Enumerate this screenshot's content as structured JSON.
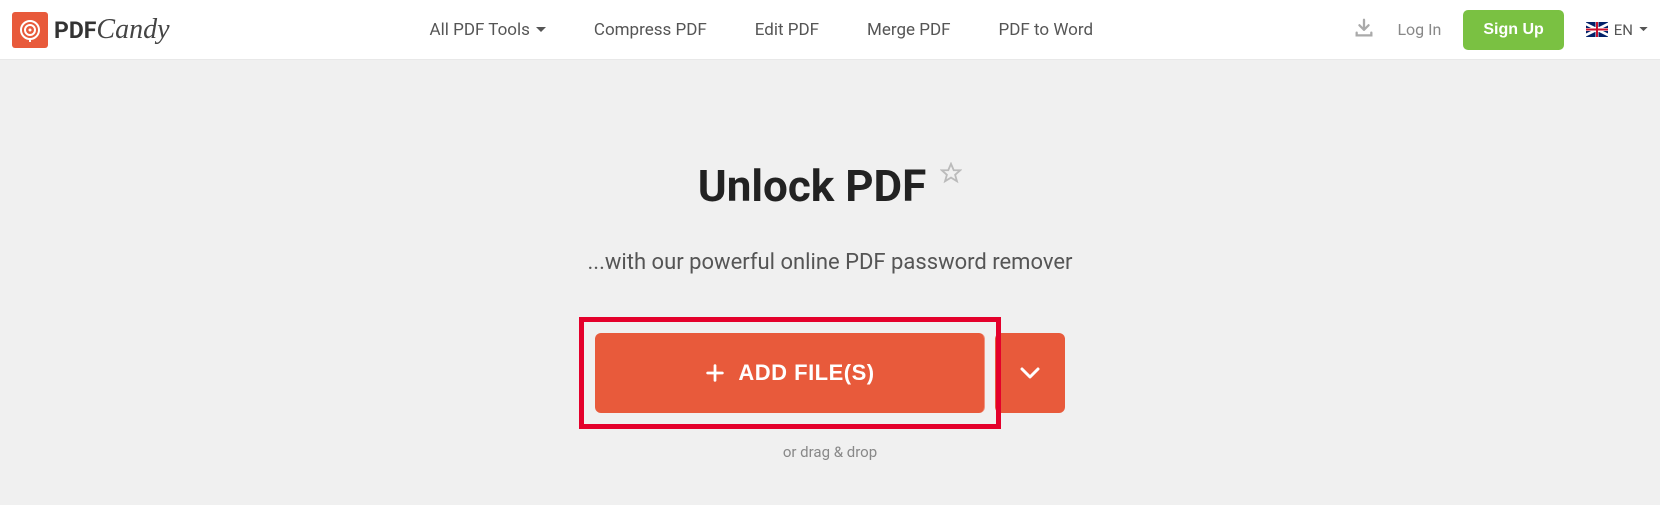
{
  "logo": {
    "pdf": "PDF",
    "candy": "Candy"
  },
  "nav": {
    "all_tools": "All PDF Tools",
    "compress": "Compress PDF",
    "edit": "Edit PDF",
    "merge": "Merge PDF",
    "to_word": "PDF to Word"
  },
  "auth": {
    "login": "Log In",
    "signup": "Sign Up"
  },
  "lang": {
    "code": "EN"
  },
  "page": {
    "title": "Unlock PDF",
    "subtitle": "...with our powerful online PDF password remover",
    "add_files": "ADD FILE(S)",
    "drag": "or drag & drop"
  }
}
